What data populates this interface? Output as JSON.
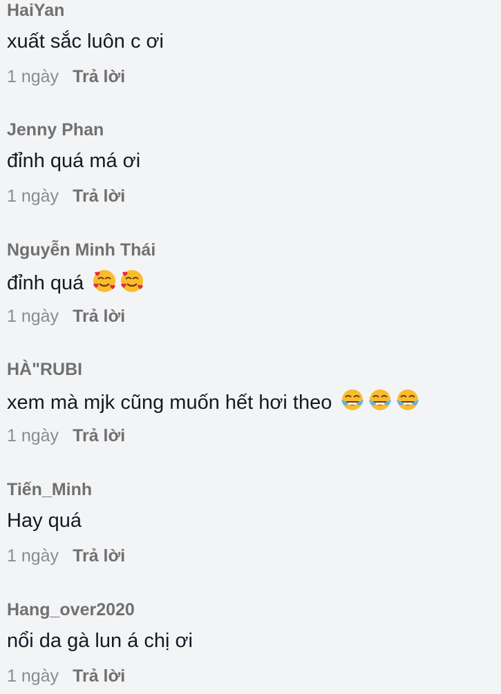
{
  "comments": [
    {
      "username": "HaiYan",
      "text": "xuất sắc luôn c ơi",
      "emoji_icon": null,
      "emoji_count": 0,
      "time": "1 ngày",
      "reply": "Trả lời"
    },
    {
      "username": "Jenny Phan",
      "text": "đỉnh quá má ơi",
      "emoji_icon": null,
      "emoji_count": 0,
      "time": "1 ngày",
      "reply": "Trả lời"
    },
    {
      "username": "Nguyễn Minh Thái",
      "text": "đỉnh quá ",
      "emoji_icon": "smiling-face-with-hearts-emoji",
      "emoji_count": 2,
      "time": "1 ngày",
      "reply": "Trả lời"
    },
    {
      "username": "HÀ\"RUBI",
      "text": "xem mà mjk cũng muốn hết hơi theo ",
      "emoji_icon": "tears-of-joy-emoji",
      "emoji_count": 3,
      "time": "1 ngày",
      "reply": "Trả lời"
    },
    {
      "username": "Tiến_Minh",
      "text": "Hay quá",
      "emoji_icon": null,
      "emoji_count": 0,
      "time": "1 ngày",
      "reply": "Trả lời"
    },
    {
      "username": "Hang_over2020",
      "text": "nổi da gà lun á chị ơi",
      "emoji_icon": null,
      "emoji_count": 0,
      "time": "1 ngày",
      "reply": "Trả lời"
    }
  ]
}
